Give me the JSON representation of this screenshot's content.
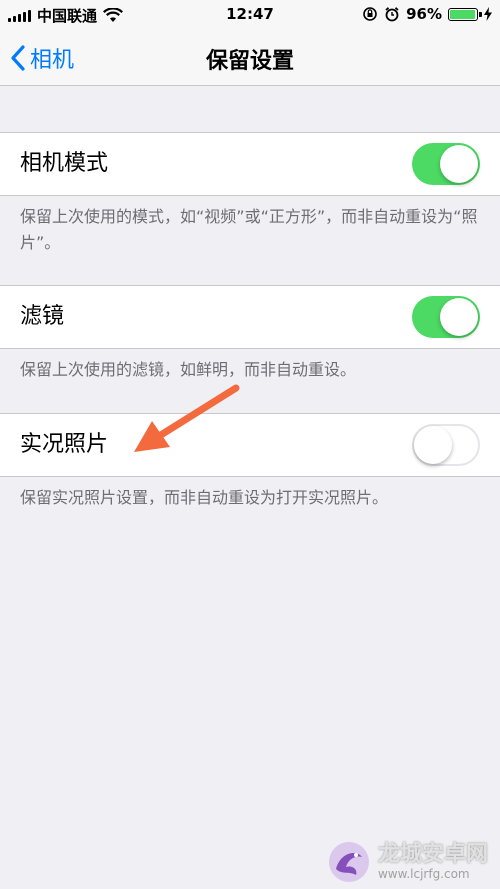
{
  "status_bar": {
    "carrier": "中国联通",
    "time": "12:47",
    "battery": "96%",
    "battery_level": 0.96
  },
  "nav": {
    "back_label": "相机",
    "title": "保留设置"
  },
  "settings": [
    {
      "label": "相机模式",
      "on": true,
      "footer": "保留上次使用的模式，如“视频”或“正方形”，而非自动重设为“照片”。"
    },
    {
      "label": "滤镜",
      "on": true,
      "footer": "保留上次使用的滤镜，如鲜明，而非自动重设。"
    },
    {
      "label": "实况照片",
      "on": false,
      "footer": "保留实况照片设置，而非自动重设为打开实况照片。"
    }
  ],
  "watermark": {
    "title": "龙城安卓网",
    "url": "www.lcjrfg.com"
  },
  "colors": {
    "accent": "#007aff",
    "toggle_on": "#4cd964",
    "arrow": "#f26a3d"
  }
}
